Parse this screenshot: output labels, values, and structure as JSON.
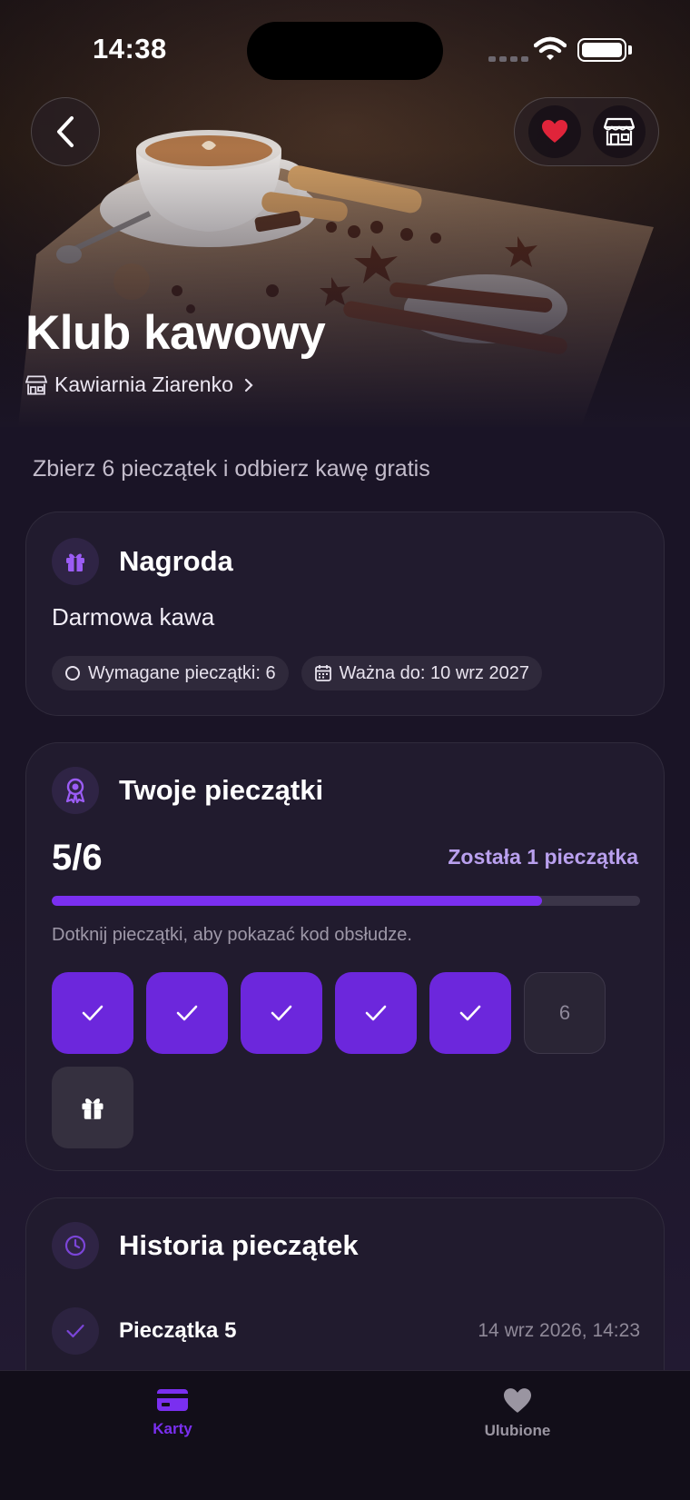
{
  "status_bar": {
    "time": "14:38"
  },
  "header": {
    "title": "Klub kawowy",
    "shop_name": "Kawiarnia Ziarenko",
    "favorite_icon": "heart-icon",
    "store_icon": "store-icon"
  },
  "subtitle": "Zbierz 6 pieczątek i odbierz kawę gratis",
  "reward_card": {
    "title": "Nagroda",
    "reward_name": "Darmowa kawa",
    "chips": [
      {
        "icon": "circle-icon",
        "label": "Wymagane pieczątki: 6"
      },
      {
        "icon": "calendar-icon",
        "label": "Ważna do: 10 wrz 2027"
      }
    ]
  },
  "stamps_card": {
    "title": "Twoje pieczątki",
    "count": "5/6",
    "remaining": "Została 1 pieczątka",
    "progress": 0.833,
    "hint": "Dotknij pieczątki, aby pokazać kod obsłudze.",
    "stamps": [
      {
        "state": "filled",
        "label": ""
      },
      {
        "state": "filled",
        "label": ""
      },
      {
        "state": "filled",
        "label": ""
      },
      {
        "state": "filled",
        "label": ""
      },
      {
        "state": "filled",
        "label": ""
      },
      {
        "state": "empty",
        "label": "6"
      },
      {
        "state": "reward",
        "label": ""
      }
    ]
  },
  "history_card": {
    "title": "Historia pieczątek",
    "items": [
      {
        "label": "Pieczątka 5",
        "date": "14 wrz 2026, 14:23"
      }
    ]
  },
  "tabbar": {
    "tabs": [
      {
        "label": "Karty",
        "icon": "card-icon",
        "active": true
      },
      {
        "label": "Ulubione",
        "icon": "heart-icon",
        "active": false
      }
    ]
  },
  "colors": {
    "accent": "#7a2ff0",
    "accent_text": "#b9a0ee",
    "favorite": "#e0243a",
    "background": "#1b1526",
    "card": "#211b2e"
  }
}
